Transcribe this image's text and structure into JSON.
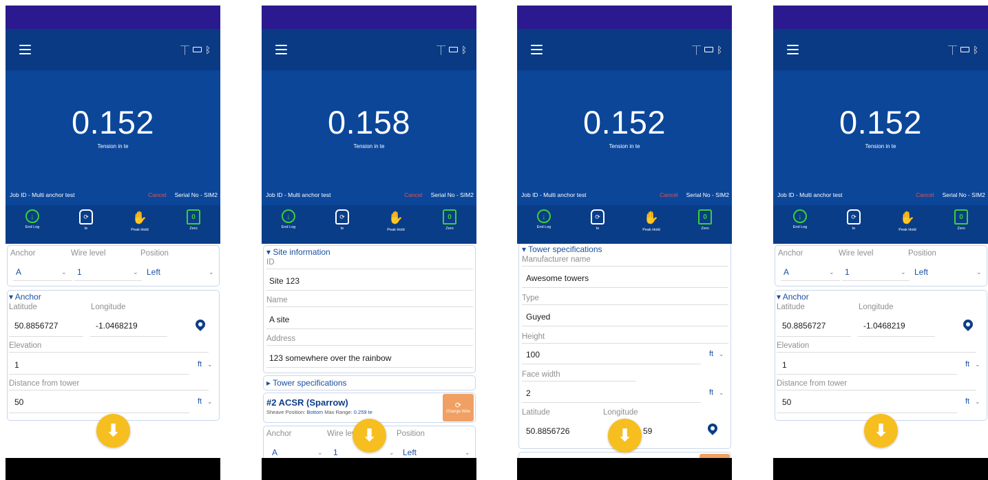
{
  "colors": {
    "status_bar": "#2b1a8f",
    "app_bar": "#0a3a83",
    "hero": "#0b4699",
    "toolbar": "#0a3d88",
    "accent_green": "#3ccf36",
    "cancel_red": "#e4544a",
    "fab_yellow": "#f6bf1f",
    "link_blue": "#1b4fa1",
    "change_orange": "#f0a062"
  },
  "icons": {
    "menu": "hamburger-menu-icon",
    "gps": "antenna-icon",
    "battery": "battery-icon",
    "bluetooth": "bluetooth-icon",
    "location": "location-pin-icon",
    "fab": "arrow-down-icon"
  },
  "screens": [
    {
      "reading": "0.152",
      "reading_label": "Tension in te",
      "job_id": "Job ID - Multi anchor test",
      "cancel": "Cancel",
      "serial": "Serial No - SIM2",
      "toolbar": {
        "end_log": "End Log",
        "units": "te",
        "peak_hold": "Peak Hold",
        "zero": "Zero"
      },
      "selector": {
        "anchor_label": "Anchor",
        "anchor_value": "A",
        "wire_label": "Wire level",
        "wire_value": "1",
        "position_label": "Position",
        "position_value": "Left"
      },
      "anchor_section": {
        "title": "▾ Anchor",
        "latitude_label": "Latitude",
        "latitude": "50.8856727",
        "longitude_label": "Longitude",
        "longitude": "-1.0468219",
        "elevation_label": "Elevation",
        "elevation": "1",
        "elevation_unit": "ft",
        "distance_label": "Distance from tower",
        "distance": "50",
        "distance_unit": "ft"
      }
    },
    {
      "reading": "0.158",
      "reading_label": "Tension in te",
      "job_id": "Job ID - Multi anchor test",
      "cancel": "Cancel",
      "serial": "Serial No - SIM2",
      "toolbar": {
        "end_log": "End Log",
        "units": "te",
        "peak_hold": "Peak Hold",
        "zero": "Zero"
      },
      "site": {
        "title": "▾ Site information",
        "id_label": "ID",
        "id": "Site 123",
        "name_label": "Name",
        "name": "A site",
        "address_label": "Address",
        "address": "123 somewhere over the rainbow"
      },
      "tower_spec_collapsed": "▸ Tower specifications",
      "tower": {
        "title": "#2 ACSR (Sparrow)",
        "sheave_label": "Sheave Position:",
        "sheave_value": "Bottom",
        "max_label": "Max Range:",
        "max_value": "0.259 te",
        "change_label": "Change Wire"
      },
      "selector": {
        "anchor_label": "Anchor",
        "anchor_value": "A",
        "wire_label": "Wire level",
        "wire_value": "1",
        "position_label": "Position",
        "position_value": "Left"
      }
    },
    {
      "reading": "0.152",
      "reading_label": "Tension in te",
      "job_id": "Job ID - Multi anchor test",
      "cancel": "Cancel",
      "serial": "Serial No - SIM2",
      "toolbar": {
        "end_log": "End Log",
        "units": "te",
        "peak_hold": "Peak Hold",
        "zero": "Zero"
      },
      "tower_spec": {
        "title": "▾ Tower specifications",
        "manufacturer_label": "Manufacturer name",
        "manufacturer": "Awesome towers",
        "type_label": "Type",
        "type": "Guyed",
        "height_label": "Height",
        "height": "100",
        "height_unit": "ft",
        "face_label": "Face width",
        "face": "2",
        "face_unit": "ft",
        "latitude_label": "Latitude",
        "latitude": "50.8856726",
        "longitude_label": "Longitude",
        "longitude_visible": "59"
      }
    },
    {
      "reading": "0.152",
      "reading_label": "Tension in te",
      "job_id": "Job ID - Multi anchor test",
      "cancel": "Cancel",
      "serial": "Serial No - SIM2",
      "toolbar": {
        "end_log": "End Log",
        "units": "te",
        "peak_hold": "Peak Hold",
        "zero": "Zero"
      },
      "selector": {
        "anchor_label": "Anchor",
        "anchor_value": "A",
        "wire_label": "Wire level",
        "wire_value": "1",
        "position_label": "Position",
        "position_value": "Left"
      },
      "anchor_section": {
        "title": "▾ Anchor",
        "latitude_label": "Latitude",
        "latitude": "50.8856727",
        "longitude_label": "Longitude",
        "longitude": "-1.0468219",
        "elevation_label": "Elevation",
        "elevation": "1",
        "elevation_unit": "ft",
        "distance_label": "Distance from tower",
        "distance": "50",
        "distance_unit": "ft"
      }
    }
  ]
}
